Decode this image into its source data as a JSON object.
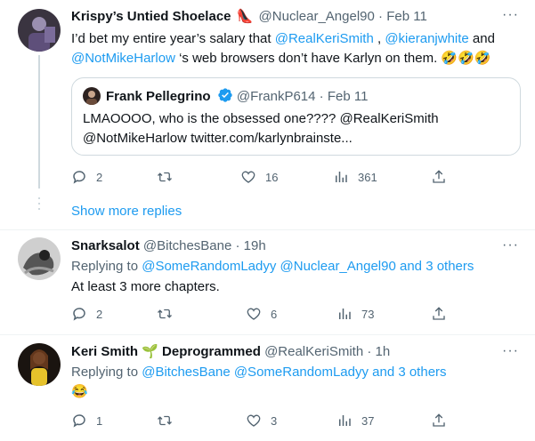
{
  "tweets": [
    {
      "name": "Krispy’s Untied Shoelace",
      "handle": "@Nuclear_Angel90",
      "date": "· Feb 11",
      "text_line1_a": "I’d bet my entire year’s salary that ",
      "mention1": "@RealKeriSmith",
      "text_line1_b": " , ",
      "mention2": "@kieranjwhite",
      "text_line1_c": " and",
      "mention3": "@NotMikeHarlow",
      "text_line2": "  ‘s web browsers don’t have Karlyn on them. 🤣🤣🤣",
      "replies": "2",
      "likes": "16",
      "views": "361"
    },
    {
      "name": "Snarksalot",
      "handle": "@BitchesBane",
      "date": "· 19h",
      "reply_prefix": "Replying to ",
      "reply_to": "@SomeRandomLadyy @Nuclear_Angel90 and 3 others",
      "text": "At least 3 more chapters.",
      "replies": "2",
      "likes": "6",
      "views": "73"
    },
    {
      "name": "Keri Smith 🌱 Deprogrammed",
      "handle": "@RealKeriSmith",
      "date": "· 1h",
      "reply_prefix": "Replying to ",
      "reply_to": "@BitchesBane @SomeRandomLadyy and 3 others",
      "text": "😂",
      "replies": "1",
      "likes": "3",
      "views": "37"
    }
  ],
  "quote": {
    "name": "Frank Pellegrino",
    "handle": "@FrankP614",
    "date": "· Feb 11",
    "line1": "LMAOOOO, who is the obsessed one???? @RealKeriSmith",
    "line2": "@NotMikeHarlow twitter.com/karlynbrainste..."
  },
  "show_more_replies": "Show more replies",
  "more_glyph": "···",
  "colors": {
    "accent": "#1d9bf0",
    "muted": "#536471",
    "border": "#cfd9de"
  },
  "icons": [
    "reply-icon",
    "retweet-icon",
    "like-icon",
    "views-icon",
    "share-icon",
    "verified-badge-icon",
    "more-icon"
  ]
}
